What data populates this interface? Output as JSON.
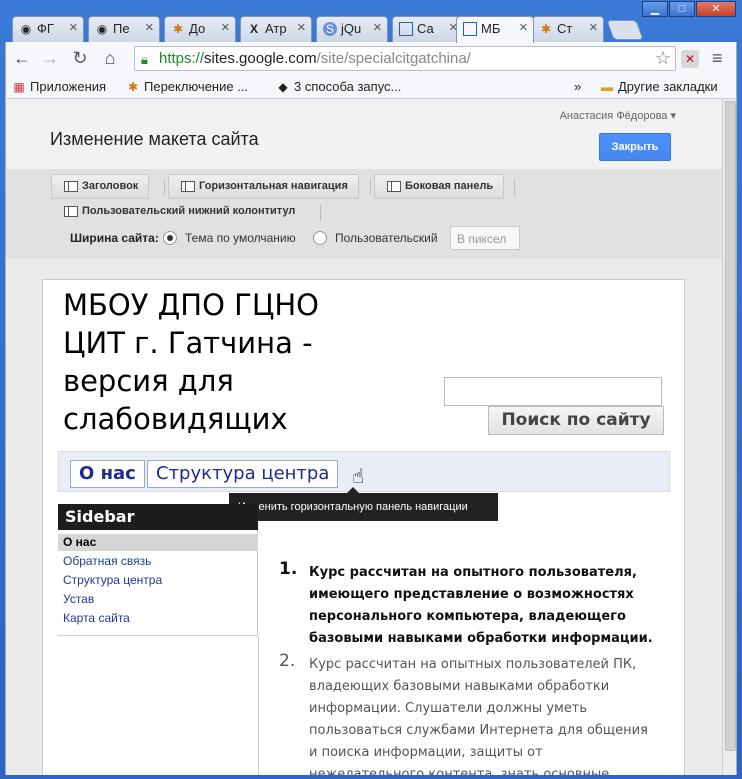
{
  "tabs": [
    {
      "label": "ФГ",
      "icon": "chrome-icon"
    },
    {
      "label": "Пе",
      "icon": "chrome-icon"
    },
    {
      "label": "До",
      "icon": "joomla-icon"
    },
    {
      "label": "Атр",
      "icon": "xhtml-icon"
    },
    {
      "label": "jQu",
      "icon": "s-icon"
    },
    {
      "label": "Са",
      "icon": "sites-icon"
    },
    {
      "label": "МБ",
      "icon": "sites-icon"
    },
    {
      "label": "Ст",
      "icon": "joomla-icon"
    }
  ],
  "window_buttons": {
    "minimize": "▁",
    "maximize": "□",
    "close": "✕"
  },
  "address": {
    "https": "https://",
    "host": "sites.google.com",
    "path": "/site/specialcitgatchina/"
  },
  "bookmarks": {
    "apps": "Приложения",
    "item1": "Переключение ...",
    "item2": "3 способа запус...",
    "overflow": "»",
    "other": "Другие закладки"
  },
  "editor": {
    "page_title": "Изменение макета сайта",
    "user": "Анастасия Фёдорова",
    "close_label": "Закрыть",
    "buttons": {
      "header": "Заголовок",
      "hnav": "Горизонтальная навигация",
      "sidebar": "Боковая панель",
      "footer": "Пользовательский нижний колонтитул"
    },
    "width_label": "Ширина сайта:",
    "width_default": "Тема по умолчанию",
    "width_custom": "Пользовательский",
    "px_placeholder": "В пиксел"
  },
  "site": {
    "title": "МБОУ ДПО ГЦНО ЦИТ г. Гатчина - версия для слабовидящих",
    "search_button": "Поиск по сайту",
    "nav": [
      "О нас",
      "Структура центра"
    ],
    "tooltip": "Изменить горизонтальную панель навигации",
    "sidebar_title": "Sidebar",
    "sidebar_items": [
      "О нас",
      "Обратная связь",
      "Структура центра",
      "Устав",
      "Карта сайта"
    ],
    "list": [
      {
        "num": "1.",
        "text": "Курс рассчитан на опытного пользователя, имеющего представление о возможностях персонального компьютера, владеющего базовыми навыками обработки информации."
      },
      {
        "num": "2.",
        "text": "Курс рассчитан на опытных пользователей ПК, владеющих базовыми навыками обработки информации. Слушатели должны  уметь пользоваться службами Интернета для общения и поиска информации, защиты от нежелательного контента, знать основные правила поведения"
      }
    ]
  }
}
